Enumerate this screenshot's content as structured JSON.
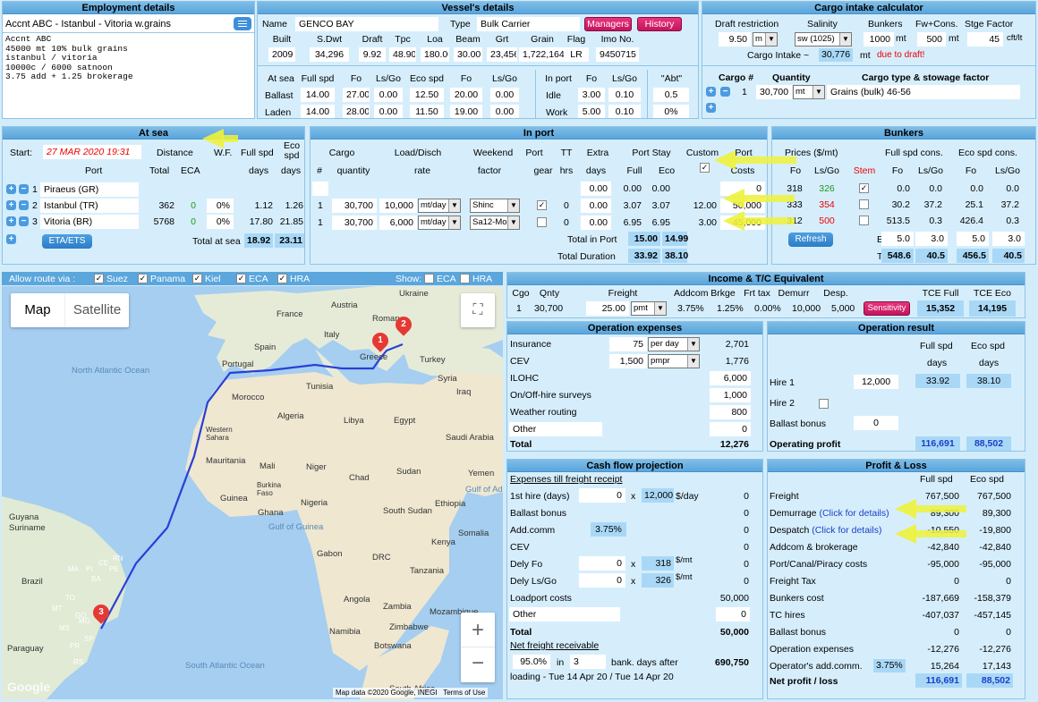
{
  "employment": {
    "title": "Employment details",
    "header": "Accnt ABC - Istanbul - Vitoria w.grains",
    "notes": [
      "Accnt ABC",
      "45000 mt 10% bulk grains",
      "istanbul / vitoria",
      "10000c / 6000 satnoon",
      "3.75 add + 1.25 brokerage"
    ]
  },
  "vessel": {
    "title": "Vessel's details",
    "name_label": "Name",
    "name": "GENCO BAY",
    "type_label": "Type",
    "type": "Bulk Carrier",
    "managers": "Managers",
    "history": "History",
    "cols": [
      "Built",
      "S.Dwt",
      "Draft",
      "Tpc",
      "Loa",
      "Beam",
      "Grt",
      "Grain",
      "Flag",
      "Imo No."
    ],
    "vals": [
      "2009",
      "34,296",
      "9.92",
      "48.90",
      "180.00",
      "30.00",
      "23,456",
      "1,722,164",
      "LR",
      "9450715"
    ],
    "sp_cols": [
      "At sea",
      "Full spd",
      "Fo",
      "Ls/Go",
      "Eco spd",
      "Fo",
      "Ls/Go"
    ],
    "ballast": [
      "Ballast",
      "14.00",
      "27.00",
      "0.00",
      "12.50",
      "20.00",
      "0.00"
    ],
    "laden": [
      "Laden",
      "14.00",
      "28.00",
      "0.00",
      "11.50",
      "19.00",
      "0.00"
    ],
    "port_cols": [
      "In port",
      "Fo",
      "Ls/Go"
    ],
    "idle": [
      "Idle",
      "3.00",
      "0.10"
    ],
    "work": [
      "Work",
      "5.00",
      "0.10"
    ],
    "abt_label": "\"Abt\"",
    "abt1": "0.5",
    "abt2": "0%"
  },
  "cargo_calc": {
    "title": "Cargo intake calculator",
    "draft_label": "Draft restriction",
    "draft": "9.50",
    "draft_unit": "m",
    "salinity_label": "Salinity",
    "salinity": "sw (1025)",
    "bunkers_label": "Bunkers",
    "bunkers": "1000",
    "fw_label": "Fw+Cons.",
    "fw": "500",
    "stge_label": "Stge Factor",
    "stge": "45",
    "mt": "mt",
    "cft": "cft/lt",
    "intake_label": "Cargo Intake ~",
    "intake": "30,776",
    "intake_unit": "mt",
    "due": "due to draft!",
    "cargo_hdr": "Cargo #",
    "qty_hdr": "Quantity",
    "type_hdr": "Cargo type & stowage factor",
    "c_no": "1",
    "c_qty": "30,700",
    "c_unit": "mt",
    "c_type": "Grains (bulk)  46-56"
  },
  "atsea": {
    "title": "At sea",
    "start_label": "Start:",
    "start": "27 MAR 2020 19:31",
    "distance": "Distance",
    "wf": "W.F.",
    "fullspd": "Full spd",
    "ecospd": "Eco spd",
    "port": "Port",
    "total": "Total",
    "eca": "ECA",
    "days": "days",
    "rows": [
      {
        "n": "1",
        "port": "Piraeus (GR)",
        "total": "",
        "eca": "",
        "wf": "",
        "full": "",
        "eco": ""
      },
      {
        "n": "2",
        "port": "Istanbul (TR)",
        "total": "362",
        "eca": "0",
        "wf": "0%",
        "full": "1.12",
        "eco": "1.26"
      },
      {
        "n": "3",
        "port": "Vitoria (BR)",
        "total": "5768",
        "eca": "0",
        "wf": "0%",
        "full": "17.80",
        "eco": "21.85"
      }
    ],
    "eta": "ETA/ETS",
    "total_label": "Total at sea",
    "tot_full": "18.92",
    "tot_eco": "23.11"
  },
  "inport": {
    "title": "In port",
    "h": [
      "Cargo",
      "Load/Disch",
      "Weekend",
      "Port",
      "TT",
      "Extra",
      "Port Stay",
      "Custom",
      "Port"
    ],
    "h2": [
      "#",
      "quantity",
      "rate",
      "factor",
      "gear",
      "hrs",
      "days",
      "Full",
      "Eco",
      "Costs"
    ],
    "rows": [
      {
        "n": "",
        "qty": "",
        "rate": "",
        "unit": "",
        "wk": "",
        "tt": "",
        "extra": "0.00",
        "full": "0.00",
        "eco": "0.00",
        "custom": "",
        "cost": "0"
      },
      {
        "n": "1",
        "qty": "30,700",
        "rate": "10,000",
        "unit": "mt/day",
        "wk": "Shinc",
        "tt": "0",
        "extra": "0.00",
        "full": "3.07",
        "eco": "3.07",
        "custom": "12.00",
        "cost": "50,000"
      },
      {
        "n": "1",
        "qty": "30,700",
        "rate": "6,000",
        "unit": "mt/day",
        "wk": "Sa12-Mo",
        "tt": "0",
        "extra": "0.00",
        "full": "6.95",
        "eco": "6.95",
        "custom": "3.00",
        "cost": "45,000"
      }
    ],
    "tip_label": "Total in Port",
    "tip_full": "15.00",
    "tip_eco": "14.99",
    "td_label": "Total Duration",
    "td_full": "33.92",
    "td_eco": "38.10"
  },
  "bunkers": {
    "title": "Bunkers",
    "prices": "Prices ($/mt)",
    "fullc": "Full spd cons.",
    "ecoc": "Eco spd cons.",
    "h": [
      "Fo",
      "Ls/Go",
      "Stem",
      "Fo",
      "Ls/Go",
      "Fo",
      "Ls/Go"
    ],
    "rows": [
      [
        "318",
        "326",
        "",
        "0.0",
        "0.0",
        "0.0",
        "0.0"
      ],
      [
        "333",
        "354",
        "",
        "30.2",
        "37.2",
        "25.1",
        "37.2"
      ],
      [
        "312",
        "500",
        "",
        "513.5",
        "0.3",
        "426.4",
        "0.3"
      ]
    ],
    "refresh": "Refresh",
    "extra_label": "Extra",
    "extra": [
      "5.0",
      "3.0",
      "5.0",
      "3.0"
    ],
    "total_label": "Total",
    "total": [
      "548.6",
      "40.5",
      "456.5",
      "40.5"
    ]
  },
  "mapbar": {
    "allow": "Allow route via :",
    "opts": [
      "Suez",
      "Panama",
      "Kiel",
      "ECA",
      "HRA"
    ],
    "show": "Show:",
    "show_opts": [
      "ECA",
      "HRA"
    ]
  },
  "map": {
    "map_btn": "Map",
    "sat_btn": "Satellite",
    "attr": "Map data ©2020 Google, INEGI",
    "terms": "Terms of Use",
    "google": "Google",
    "labels": [
      "Ukraine",
      "Austria",
      "France",
      "Roman",
      "Italy",
      "Spain",
      "Portugal",
      "Greece",
      "Turkey",
      "Syria",
      "Iraq",
      "Tunisia",
      "Morocco",
      "Algeria",
      "Libya",
      "Egypt",
      "Saudi Arabia",
      "Western Sahara",
      "Mauritania",
      "Mali",
      "Niger",
      "Chad",
      "Sudan",
      "Yemen",
      "Burkina Faso",
      "Guinea",
      "Ghana",
      "Nigeria",
      "South Sudan",
      "Ethiopia",
      "Somalia",
      "Gulf of Aden",
      "Gulf of Guinea",
      "Gabon",
      "DRC",
      "Kenya",
      "Tanzania",
      "Angola",
      "Zambia",
      "Mozambique",
      "Namibia",
      "Zimbabwe",
      "Botswana",
      "South Africa",
      "Guyana",
      "Suriname",
      "Brazil",
      "Paraguay",
      "BA",
      "PE",
      "MA",
      "CE",
      "RN",
      "PI",
      "TO",
      "GO",
      "MG",
      "MT",
      "SP",
      "MS",
      "RS",
      "PR"
    ],
    "oceans": [
      "North Atlantic Ocean",
      "South Atlantic Ocean"
    ],
    "markers": [
      "1",
      "2",
      "3"
    ]
  },
  "income": {
    "title": "Income & T/C Equivalent",
    "h": [
      "Cgo",
      "Qnty",
      "Freight",
      "Addcom",
      "Brkge",
      "Frt tax",
      "Demurr",
      "Desp.",
      "TCE Full",
      "TCE Eco"
    ],
    "cgo": "1",
    "qnty": "30,700",
    "freight": "25.00",
    "funit": "pmt",
    "addcom": "3.75%",
    "brkge": "1.25%",
    "frttax": "0.00%",
    "demurr": "10,000",
    "desp": "5,000",
    "sens": "Sensitivity",
    "tce_full": "15,352",
    "tce_eco": "14,195"
  },
  "opex": {
    "title": "Operation expenses",
    "rows": [
      {
        "l": "Insurance",
        "v": "75",
        "u": "per day",
        "t": "2,701"
      },
      {
        "l": "CEV",
        "v": "1,500",
        "u": "pmpr",
        "t": "1,776"
      },
      {
        "l": "ILOHC",
        "t": "6,000"
      },
      {
        "l": "On/Off-hire surveys",
        "t": "1,000"
      },
      {
        "l": "Weather routing",
        "t": "800"
      },
      {
        "l": "Other",
        "t": "0"
      }
    ],
    "total_label": "Total",
    "total": "12,276"
  },
  "opres": {
    "title": "Operation result",
    "full": "Full spd",
    "eco": "Eco spd",
    "days": "days",
    "hire1": "Hire 1",
    "hire1_v": "12,000",
    "hire1_full": "33.92",
    "hire1_eco": "38.10",
    "hire2": "Hire 2",
    "ballast": "Ballast bonus",
    "ballast_v": "0",
    "op_label": "Operating profit",
    "op_full": "116,691",
    "op_eco": "88,502"
  },
  "cash": {
    "title": "Cash flow projection",
    "sub": "Expenses till freight receipt",
    "first": "1st hire (days)",
    "first_n": "0",
    "x": "x",
    "first_r": "12,000",
    "first_u": "$/day",
    "first_t": "0",
    "ballast": "Ballast bonus",
    "ballast_t": "0",
    "add": "Add.comm",
    "add_p": "3.75%",
    "add_t": "0",
    "cev": "CEV",
    "cev_t": "0",
    "dfo": "Dely Fo",
    "dfo_n": "0",
    "dfo_p": "318",
    "dfo_t": "0",
    "dls": "Dely Ls/Go",
    "dls_n": "0",
    "dls_p": "326",
    "dls_t": "0",
    "smt": "$/mt",
    "load": "Loadport costs",
    "load_t": "50,000",
    "other": "Other",
    "other_t": "0",
    "total": "Total",
    "total_t": "50,000",
    "net": "Net freight receivable",
    "pct": "95.0%",
    "in": "in",
    "days": "3",
    "bank": "bank. days after",
    "net_t": "690,750",
    "loading": "loading - Tue 14 Apr 20 / Tue 14 Apr 20"
  },
  "pl": {
    "title": "Profit & Loss",
    "full": "Full spd",
    "eco": "Eco spd",
    "rows": [
      {
        "l": "Freight",
        "f": "767,500",
        "e": "767,500"
      },
      {
        "l": "Demurrage",
        "link": "(Click for details)",
        "f": "89,300",
        "e": "89,300"
      },
      {
        "l": "Despatch",
        "link": "(Click for details)",
        "f": "-10,550",
        "e": "-19,800"
      },
      {
        "l": "Addcom & brokerage",
        "f": "-42,840",
        "e": "-42,840"
      },
      {
        "l": "Port/Canal/Piracy costs",
        "f": "-95,000",
        "e": "-95,000"
      },
      {
        "l": "Freight Tax",
        "f": "0",
        "e": "0"
      },
      {
        "l": "Bunkers cost",
        "f": "-187,669",
        "e": "-158,379"
      },
      {
        "l": "TC hires",
        "f": "-407,037",
        "e": "-457,145"
      },
      {
        "l": "Ballast bonus",
        "f": "0",
        "e": "0"
      },
      {
        "l": "Operation expenses",
        "f": "-12,276",
        "e": "-12,276"
      },
      {
        "l": "Operator's add.comm.",
        "pct": "3.75%",
        "f": "15,264",
        "e": "17,143"
      }
    ],
    "net": "Net profit / loss",
    "net_f": "116,691",
    "net_e": "88,502"
  }
}
